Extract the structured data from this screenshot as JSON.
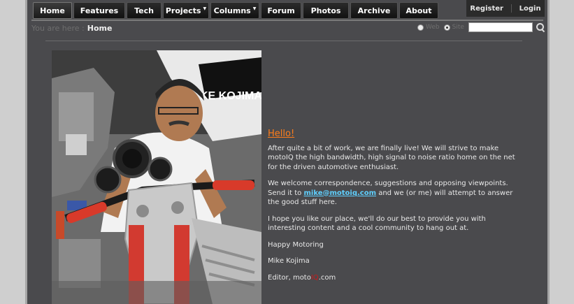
{
  "nav": {
    "items": [
      {
        "label": "Home"
      },
      {
        "label": "Features"
      },
      {
        "label": "Tech"
      },
      {
        "label": "Projects"
      },
      {
        "label": "Columns"
      },
      {
        "label": "Forum"
      },
      {
        "label": "Photos"
      },
      {
        "label": "Archive"
      },
      {
        "label": "About"
      }
    ],
    "register": "Register",
    "login": "Login"
  },
  "breadcrumb": {
    "prefix": "You are here :",
    "current": "Home"
  },
  "search": {
    "option_web": "Web",
    "option_site": "Site",
    "value": ""
  },
  "article": {
    "heading": "Hello!",
    "p1": "After quite a bit of work, we are finally live!  We will strive to make motoIQ the high bandwidth, high signal to noise ratio home on the net for the driven automotive enthusiast.",
    "p2_before": "We welcome correspondence, suggestions and opposing viewpoints.  Send it to ",
    "email": "mike@motoiq.com",
    "p2_after": " and we (or me) will attempt to answer the good stuff here.",
    "p3": "I hope you like our place, we'll do our best to provide you with interesting content and a cool community to hang out at.",
    "p4": "Happy Motoring",
    "p5": "Mike Kojima",
    "p6_prefix": "Editor,  moto",
    "p6_iq": "IQ",
    "p6_suffix": ".com"
  },
  "photo": {
    "shirt_text": "KE KOJIMA"
  },
  "colors": {
    "accent_heading": "#ff7d1a",
    "link": "#5fd0ff",
    "brand_iq": "#cc1a1a",
    "panel": "#4a4a4d"
  }
}
